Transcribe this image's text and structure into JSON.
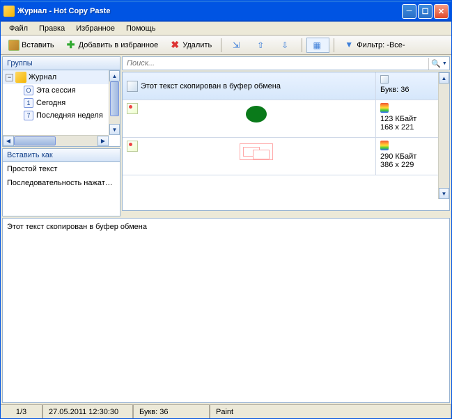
{
  "window": {
    "title": "Журнал - Hot Copy Paste"
  },
  "menu": {
    "file": "Файл",
    "edit": "Правка",
    "favorites": "Избранное",
    "help": "Помощь"
  },
  "toolbar": {
    "paste": "Вставить",
    "add_fav": "Добавить в избранное",
    "delete": "Удалить",
    "filter_label": "Фильтр:",
    "filter_value": "-Все-"
  },
  "groups": {
    "header": "Группы",
    "root": "Журнал",
    "items": [
      {
        "badge": "О",
        "label": "Эта сессия"
      },
      {
        "badge": "1",
        "label": "Сегодня"
      },
      {
        "badge": "7",
        "label": "Последняя неделя"
      }
    ]
  },
  "paste_as": {
    "header": "Вставить как",
    "items": [
      "Простой текст",
      "Последовательность нажати..."
    ]
  },
  "search": {
    "placeholder": "Поиск..."
  },
  "clips": [
    {
      "type": "text",
      "text": "Этот текст скопирован в буфер обмена",
      "meta1": "Букв: 36",
      "meta2": ""
    },
    {
      "type": "image",
      "text": "",
      "meta1": "123 КБайт",
      "meta2": "168 x 221"
    },
    {
      "type": "image",
      "text": "",
      "meta1": "290 КБайт",
      "meta2": "386 x 229"
    }
  ],
  "preview": {
    "text": "Этот текст скопирован в буфер обмена"
  },
  "status": {
    "index": "1/3",
    "datetime": "27.05.2011 12:30:30",
    "chars": "Букв: 36",
    "app": "Paint"
  }
}
